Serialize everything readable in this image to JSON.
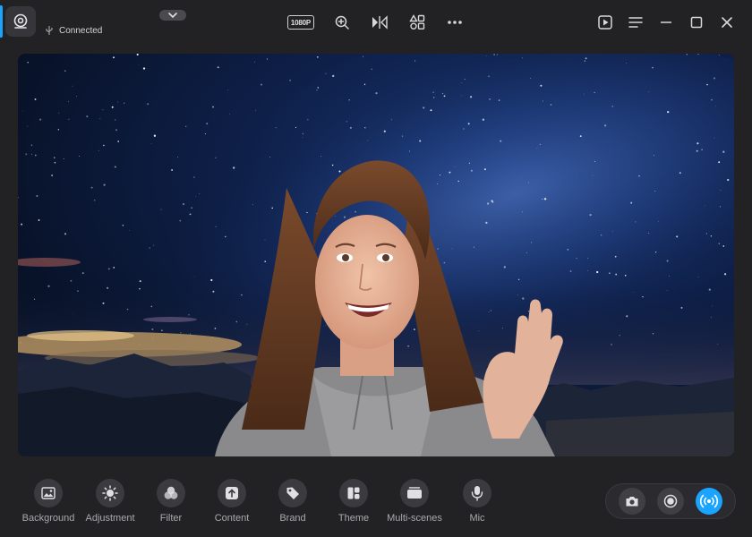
{
  "status": {
    "connection": "Connected"
  },
  "toolbar": {
    "resolution_label": "1080P"
  },
  "colors": {
    "accent": "#1aa3ff",
    "background": "#222225",
    "button": "#3a3a3f"
  },
  "features": [
    {
      "label": "Background",
      "icon": "image-icon"
    },
    {
      "label": "Adjustment",
      "icon": "sun-icon"
    },
    {
      "label": "Filter",
      "icon": "filter-icon"
    },
    {
      "label": "Content",
      "icon": "upload-icon"
    },
    {
      "label": "Brand",
      "icon": "tag-icon"
    },
    {
      "label": "Theme",
      "icon": "layout-icon"
    },
    {
      "label": "Multi-scenes",
      "icon": "scenes-icon"
    },
    {
      "label": "Mic",
      "icon": "mic-icon"
    }
  ],
  "capture": {
    "snapshot_icon": "camera-icon",
    "record_icon": "record-icon",
    "live_icon": "broadcast-icon"
  }
}
